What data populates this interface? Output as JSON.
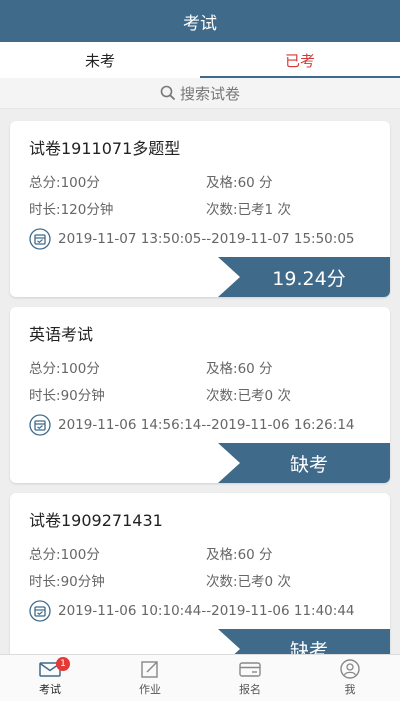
{
  "header": {
    "title": "考试"
  },
  "tabs": [
    {
      "label": "未考",
      "active": false
    },
    {
      "label": "已考",
      "active": true
    }
  ],
  "search": {
    "placeholder": "搜索试卷",
    "icon": "search-icon"
  },
  "colors": {
    "primary": "#3f6a8a",
    "active_tab": "#d23a3a",
    "badge": "#e53935"
  },
  "cards": [
    {
      "title": "试卷1911071多题型",
      "total_label": "总分:",
      "total": "100分",
      "pass_label": "及格:",
      "pass": "60 分",
      "duration_label": "时长:",
      "duration": "120分钟",
      "attempts_label": "次数:",
      "attempts": "已考1 次",
      "time_range": "2019-11-07 13:50:05--2019-11-07 15:50:05",
      "result": "19.24分"
    },
    {
      "title": "英语考试",
      "total_label": "总分:",
      "total": "100分",
      "pass_label": "及格:",
      "pass": "60 分",
      "duration_label": "时长:",
      "duration": "90分钟",
      "attempts_label": "次数:",
      "attempts": "已考0 次",
      "time_range": "2019-11-06 14:56:14--2019-11-06 16:26:14",
      "result": "缺考"
    },
    {
      "title": "试卷1909271431",
      "total_label": "总分:",
      "total": "100分",
      "pass_label": "及格:",
      "pass": "60 分",
      "duration_label": "时长:",
      "duration": "90分钟",
      "attempts_label": "次数:",
      "attempts": "已考0 次",
      "time_range": "2019-11-06 10:10:44--2019-11-06 11:40:44",
      "result": "缺考"
    }
  ],
  "bottom_nav": [
    {
      "label": "考试",
      "icon": "mail-icon",
      "badge": "1",
      "active": true
    },
    {
      "label": "作业",
      "icon": "edit-icon",
      "active": false
    },
    {
      "label": "报名",
      "icon": "card-icon",
      "active": false
    },
    {
      "label": "我",
      "icon": "user-icon",
      "active": false
    }
  ]
}
